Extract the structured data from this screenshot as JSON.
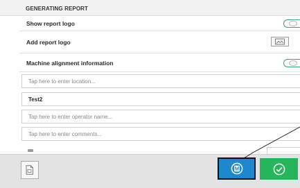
{
  "header": {
    "title": "GENERATING REPORT"
  },
  "settings": [
    {
      "label": "Show report logo",
      "control": "toggle",
      "on": true
    },
    {
      "label": "Add report logo",
      "control": "image-button"
    },
    {
      "label": "Machine alignment information",
      "control": "toggle",
      "on": true
    }
  ],
  "fields": [
    {
      "value": "",
      "placeholder": "Tap here to enter location..."
    },
    {
      "value": "Test2",
      "placeholder": ""
    },
    {
      "value": "",
      "placeholder": "Tap here to enter operator name..."
    },
    {
      "value": "",
      "placeholder": "Tap here to enter comments..."
    }
  ],
  "footer": {
    "left_icon": "document-icon",
    "save_icon": "save-disk-icon",
    "confirm_icon": "checkmark-icon"
  },
  "colors": {
    "accent_blue": "#1d88cc",
    "accent_green": "#27b55b",
    "toggle_green": "#3aa66d",
    "footer_bg": "#e3e3e3"
  }
}
